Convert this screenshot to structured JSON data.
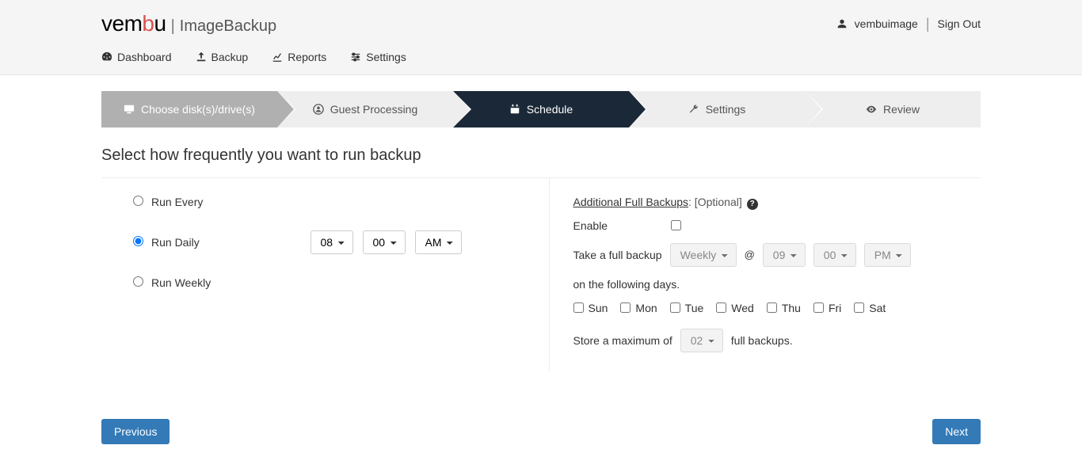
{
  "brand": {
    "logo_prefix": "vem",
    "logo_accent": "b",
    "logo_suffix": "u",
    "subtitle": "ImageBackup"
  },
  "user": {
    "name": "vembuimage",
    "signout": "Sign Out"
  },
  "nav": {
    "dashboard": "Dashboard",
    "backup": "Backup",
    "reports": "Reports",
    "settings": "Settings"
  },
  "wizard": {
    "step1": "Choose disk(s)/drive(s)",
    "step2": "Guest Processing",
    "step3": "Schedule",
    "step4": "Settings",
    "step5": "Review"
  },
  "page_title": "Select how frequently you want to run backup",
  "frequency": {
    "run_every": "Run Every",
    "run_daily": "Run Daily",
    "run_weekly": "Run Weekly",
    "daily_hour": "08",
    "daily_min": "00",
    "daily_ampm": "AM"
  },
  "fullbackup": {
    "title": "Additional Full Backups",
    "optional": ": [Optional]",
    "enable_label": "Enable",
    "take_label": "Take a full backup",
    "period": "Weekly",
    "hour": "09",
    "min": "00",
    "ampm": "PM",
    "following_days": "on the following days.",
    "days": {
      "sun": "Sun",
      "mon": "Mon",
      "tue": "Tue",
      "wed": "Wed",
      "thu": "Thu",
      "fri": "Fri",
      "sat": "Sat"
    },
    "store_prefix": "Store a maximum of",
    "store_count": "02",
    "store_suffix": "full backups."
  },
  "buttons": {
    "previous": "Previous",
    "next": "Next"
  }
}
